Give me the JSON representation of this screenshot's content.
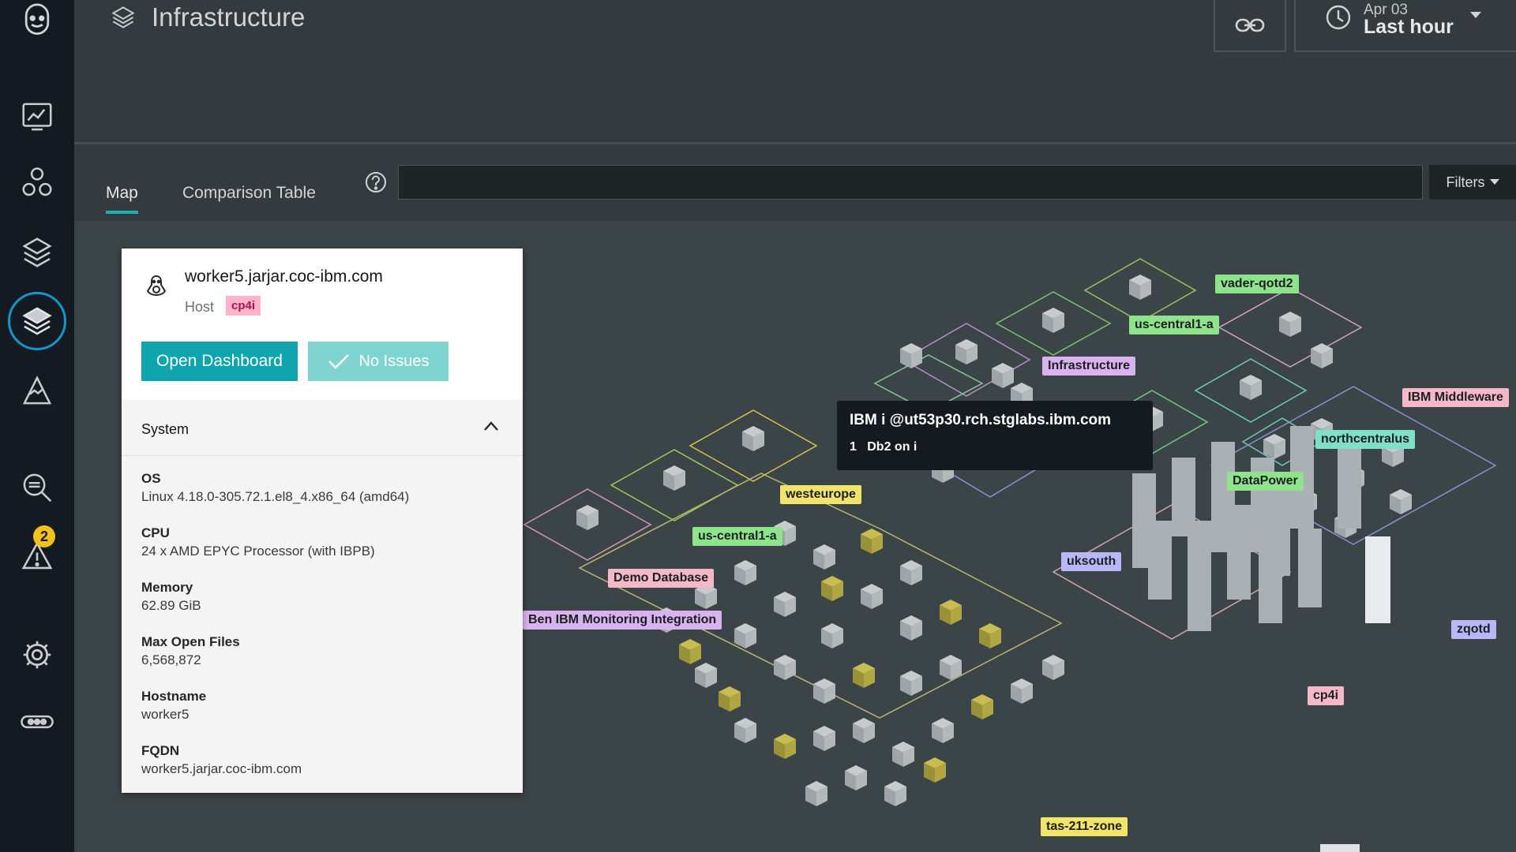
{
  "app": {
    "title": "Infrastructure"
  },
  "time": {
    "date": "Apr 03",
    "range": "Last hour"
  },
  "tabs": [
    {
      "label": "Map"
    },
    {
      "label": "Comparison Table"
    }
  ],
  "search": {
    "placeholder": "",
    "value": ""
  },
  "filters": {
    "label": "Filters"
  },
  "sidebar": {
    "alerts_badge": "2"
  },
  "map_labels": [
    "vader-qotd2",
    "us-central1-a",
    "Infrastructure",
    "IBM Middleware",
    "northcentralus",
    "DataPower",
    "westeurope",
    "us-central1-a",
    "uksouth",
    "Demo Database",
    "Ben IBM Monitoring Integration",
    "zqotd",
    "cp4i",
    "tas-211-zone"
  ],
  "tooltip": {
    "title": "IBM i @ut53p30.rch.stglabs.ibm.com",
    "count": "1",
    "item": "Db2 on i"
  },
  "panel": {
    "hostname": "worker5.jarjar.coc-ibm.com",
    "type": "Host",
    "tag": "cp4i",
    "open_dashboard": "Open Dashboard",
    "no_issues": "No Issues",
    "section": "System",
    "fields": [
      {
        "label": "OS",
        "value": "Linux 4.18.0-305.72.1.el8_4.x86_64 (amd64)"
      },
      {
        "label": "CPU",
        "value": "24 x AMD EPYC Processor (with IBPB)"
      },
      {
        "label": "Memory",
        "value": "62.89 GiB"
      },
      {
        "label": "Max Open Files",
        "value": "6,568,872"
      },
      {
        "label": "Hostname",
        "value": "worker5"
      },
      {
        "label": "FQDN",
        "value": "worker5.jarjar.coc-ibm.com"
      }
    ]
  }
}
